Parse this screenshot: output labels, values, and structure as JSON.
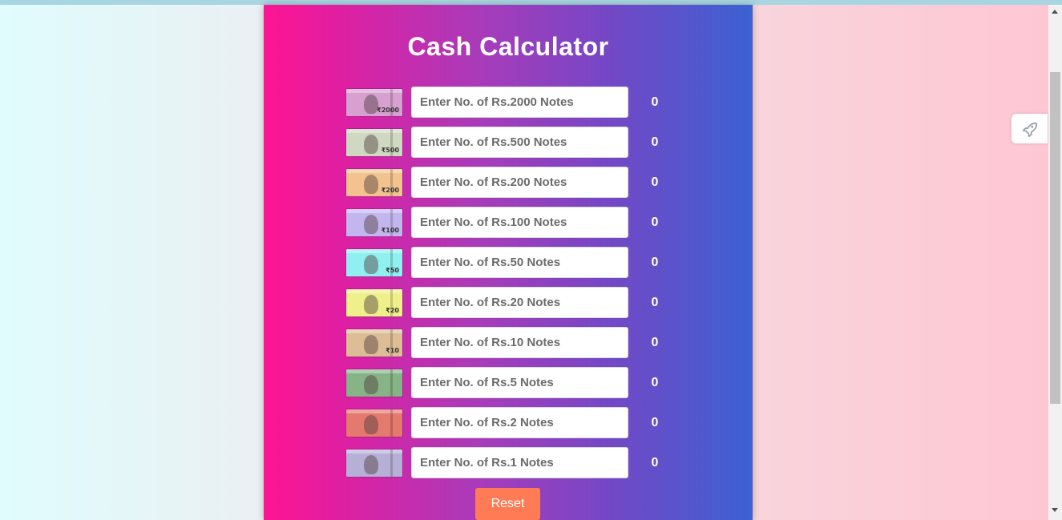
{
  "title": "Cash Calculator",
  "rows": [
    {
      "placeholder": "Enter No. of Rs.2000 Notes",
      "total": "0",
      "note_icon": "rs-2000-note-image",
      "note_color": "#d6a0cf",
      "denom": "₹2000"
    },
    {
      "placeholder": "Enter No. of Rs.500 Notes",
      "total": "0",
      "note_icon": "rs-500-note-image",
      "note_color": "#cfd8c1",
      "denom": "₹500"
    },
    {
      "placeholder": "Enter No. of Rs.200 Notes",
      "total": "0",
      "note_icon": "rs-200-note-image",
      "note_color": "#f2c38e",
      "denom": "₹200"
    },
    {
      "placeholder": "Enter No. of Rs.100 Notes",
      "total": "0",
      "note_icon": "rs-100-note-image",
      "note_color": "#c3b6ef",
      "denom": "₹100"
    },
    {
      "placeholder": "Enter No. of Rs.50 Notes",
      "total": "0",
      "note_icon": "rs-50-note-image",
      "note_color": "#8ff0ef",
      "denom": "₹50"
    },
    {
      "placeholder": "Enter No. of Rs.20 Notes",
      "total": "0",
      "note_icon": "rs-20-note-image",
      "note_color": "#eff08a",
      "denom": "₹20"
    },
    {
      "placeholder": "Enter No. of Rs.10 Notes",
      "total": "0",
      "note_icon": "rs-10-note-image",
      "note_color": "#dcbd96",
      "denom": "₹10"
    },
    {
      "placeholder": "Enter No. of Rs.5 Notes",
      "total": "0",
      "note_icon": "rs-5-note-image",
      "note_color": "#86b486",
      "denom": ""
    },
    {
      "placeholder": "Enter No. of Rs.2 Notes",
      "total": "0",
      "note_icon": "rs-2-note-image",
      "note_color": "#e4796d",
      "denom": ""
    },
    {
      "placeholder": "Enter No. of Rs.1 Notes",
      "total": "0",
      "note_icon": "rs-1-note-image",
      "note_color": "#b7b0d6",
      "denom": ""
    }
  ],
  "reset_label": "Reset",
  "side_widget_icon": "rocket-icon",
  "colors": {
    "panel_gradient_start": "#ff1493",
    "panel_gradient_end": "#3c62d3",
    "reset_button": "#ff7b56"
  }
}
